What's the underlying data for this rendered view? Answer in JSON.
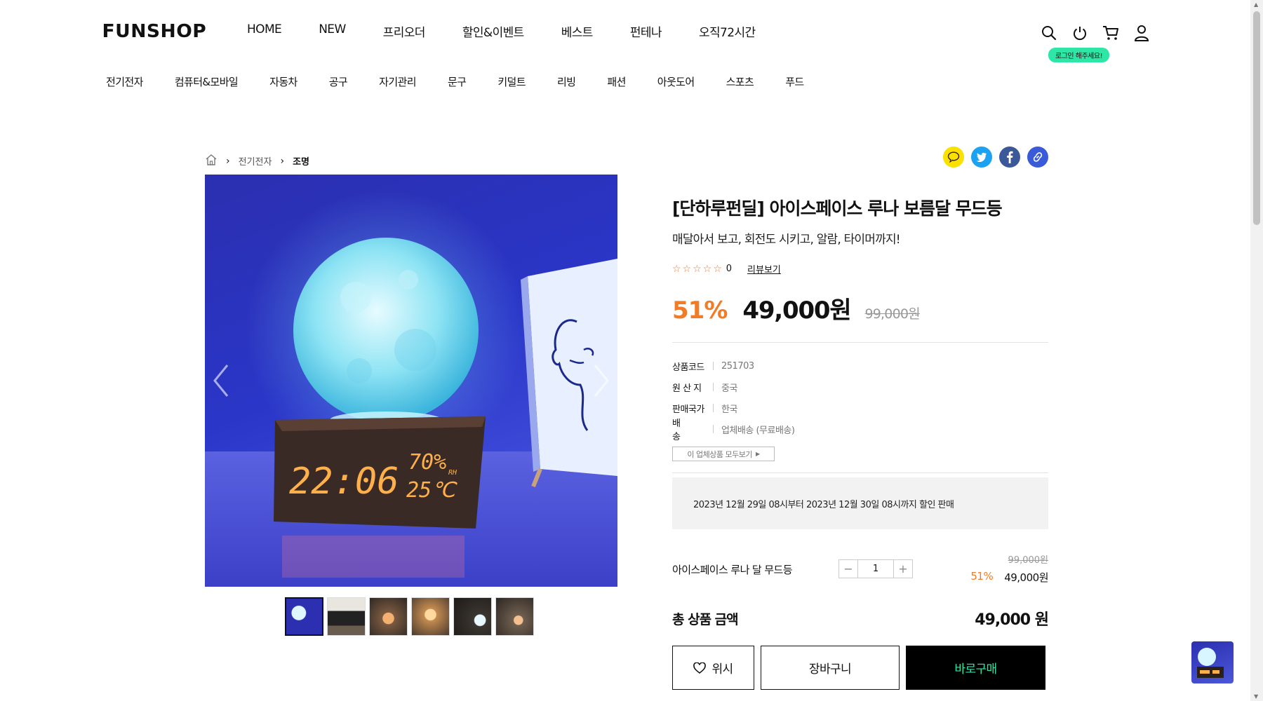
{
  "header": {
    "logo": "FUNSHOP",
    "nav": [
      "HOME",
      "NEW",
      "프리오더",
      "할인&이벤트",
      "베스트",
      "펀테나",
      "오직72시간"
    ],
    "login_bubble": "로그인 해주세요!",
    "icons": [
      "search-icon",
      "power-icon",
      "cart-icon",
      "user-icon"
    ]
  },
  "categories": [
    "전기전자",
    "컴퓨터&모바일",
    "자동차",
    "공구",
    "자기관리",
    "문구",
    "키덜트",
    "리빙",
    "패션",
    "아웃도어",
    "스포츠",
    "푸드"
  ],
  "breadcrumb": {
    "home_icon": "home-icon",
    "level1": "전기전자",
    "level2": "조명",
    "separator": "›"
  },
  "share_icons": [
    {
      "name": "kakaotalk-icon",
      "color": "#FAE100"
    },
    {
      "name": "twitter-icon",
      "color": "#1DA1F2"
    },
    {
      "name": "facebook-icon",
      "color": "#3B5998"
    },
    {
      "name": "link-icon",
      "color": "#3A5BD9"
    }
  ],
  "gallery": {
    "clock_time": "22:06",
    "humidity": "70%",
    "humidity_unit": "RH",
    "temperature": "25℃",
    "thumb_count": 6,
    "active_thumb": 0
  },
  "product": {
    "title": "[단하루펀딜] 아이스페이스 루나 보름달 무드등",
    "subtitle": "매달아서 보고, 회전도 시키고, 알람, 타이머까지!",
    "stars": "☆☆☆☆☆",
    "review_count": "0",
    "review_link": "리뷰보기",
    "discount": "51%",
    "price": "49,000원",
    "original_price": "99,000원",
    "specs": [
      {
        "key": "상품코드",
        "value": "251703"
      },
      {
        "key": "원 산 지",
        "value": "중국"
      },
      {
        "key": "판매국가",
        "value": "한국"
      },
      {
        "key": "배 송",
        "value": "업체배송 (무료배송)"
      }
    ],
    "vendor_button": "이 업체상품 모두보기",
    "notice": "2023년 12월 29일 08시부터 2023년 12월 30일 08시까지 할인 판매"
  },
  "option": {
    "name": "아이스페이스 루나 달 무드등",
    "quantity": "1",
    "minus": "−",
    "plus": "+",
    "original_price": "99,000원",
    "discount": "51%",
    "price": "49,000원"
  },
  "total": {
    "label": "총 상품 금액",
    "amount": "49,000 원"
  },
  "actions": {
    "wish": "위시",
    "cart": "장바구니",
    "buy": "바로구매"
  },
  "colors": {
    "accent": "#F27B25",
    "mint": "#2EE6A6",
    "black": "#000000"
  }
}
